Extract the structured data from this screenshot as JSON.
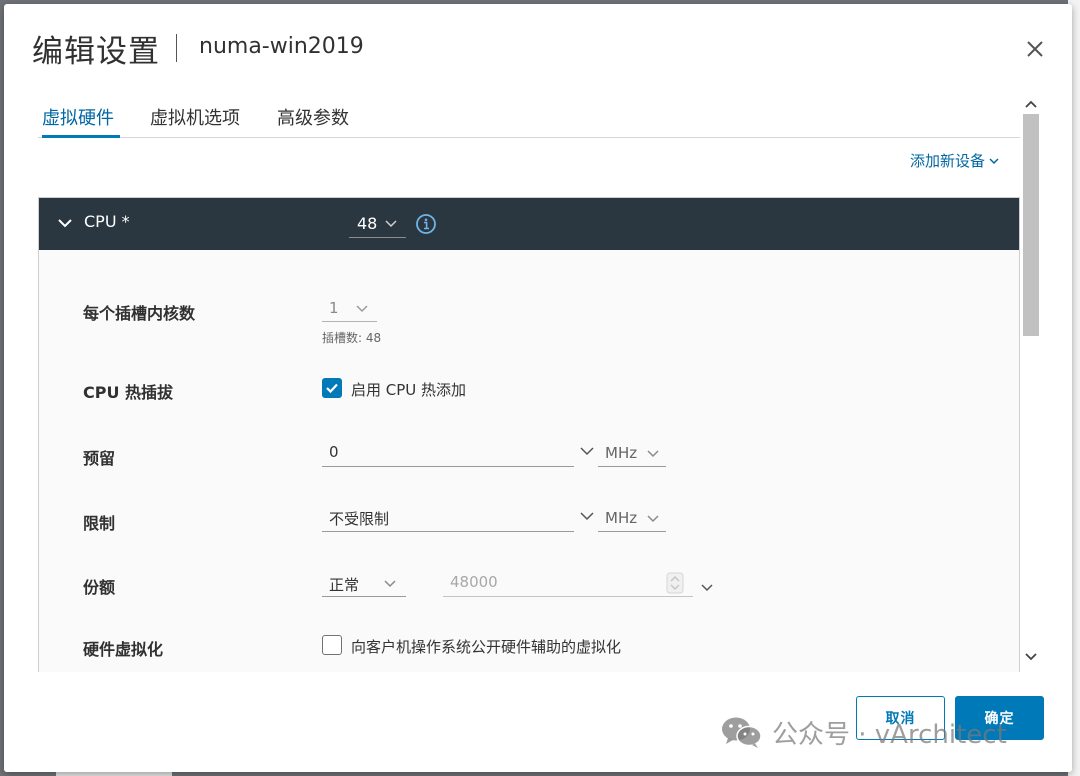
{
  "dialog": {
    "title": "编辑设置",
    "subtitle": "numa-win2019"
  },
  "tabs": [
    {
      "label": "虚拟硬件",
      "active": true
    },
    {
      "label": "虚拟机选项",
      "active": false
    },
    {
      "label": "高级参数",
      "active": false
    }
  ],
  "add_device_label": "添加新设备",
  "cpu_panel": {
    "title": "CPU *",
    "count_value": "48",
    "rows": {
      "cores_per_socket": {
        "label": "每个插槽内核数",
        "value": "1",
        "helper": "插槽数: 48"
      },
      "hot_plug": {
        "label": "CPU 热插拔",
        "checkbox_label": "启用 CPU 热添加",
        "checked": true
      },
      "reservation": {
        "label": "预留",
        "value": "0",
        "unit": "MHz"
      },
      "limit": {
        "label": "限制",
        "value": "不受限制",
        "unit": "MHz"
      },
      "shares": {
        "label": "份额",
        "level": "正常",
        "value": "48000"
      },
      "hw_virt": {
        "label": "硬件虚拟化",
        "checkbox_label": "向客户机操作系统公开硬件辅助的虚拟化",
        "checked": false
      }
    }
  },
  "footer": {
    "cancel_label": "取消",
    "ok_label": "确定"
  },
  "watermark": {
    "text": "公众号 · vArchitect"
  },
  "colors": {
    "accent": "#0079b8",
    "panel_header": "#2a3640",
    "link": "#0067a3"
  }
}
